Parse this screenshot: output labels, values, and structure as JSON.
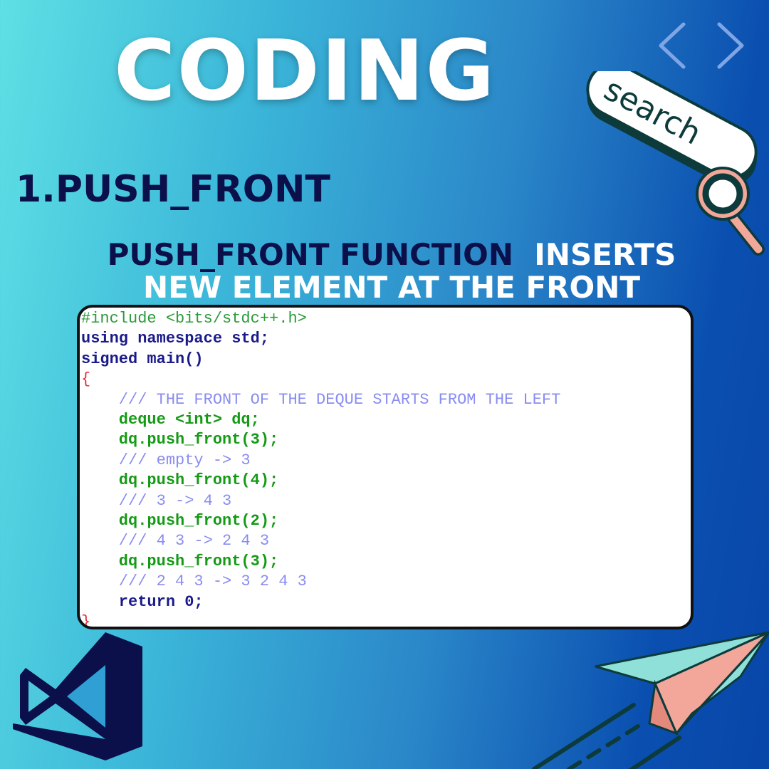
{
  "header": {
    "title": "CODING"
  },
  "section": {
    "heading": "1.PUSH_FRONT",
    "desc_dark": "PUSH_FRONT FUNCTION",
    "desc_light": "INSERTS",
    "desc_line2": "NEW ELEMENT AT THE FRONT"
  },
  "search_graphic": {
    "label": "search",
    "icon": "magnifier-icon"
  },
  "icons": {
    "nav": "code-brackets-icon",
    "logo": "visual-studio-logo-icon",
    "plane": "paper-plane-icon"
  },
  "code": {
    "lines": [
      "#include <bits/stdc++.h>",
      "using namespace std;",
      "signed main()",
      "{",
      "    /// THE FRONT OF THE DEQUE STARTS FROM THE LEFT",
      "    deque <int> dq;",
      "    dq.push_front(3);",
      "    /// empty -> 3",
      "    dq.push_front(4);",
      "    /// 3 -> 4 3",
      "    dq.push_front(2);",
      "    /// 4 3 -> 2 4 3",
      "    dq.push_front(3);",
      "    /// 2 4 3 -> 3 2 4 3",
      "    return 0;",
      "}"
    ]
  },
  "colors": {
    "bg_start": "#5ee0e4",
    "bg_end": "#0846a8",
    "title": "#ffffff",
    "dark_text": "#0b0f4a",
    "keyword": "#1a1a8a",
    "type": "#149a14",
    "comment": "#8a8cf0",
    "number": "#d040d0"
  }
}
